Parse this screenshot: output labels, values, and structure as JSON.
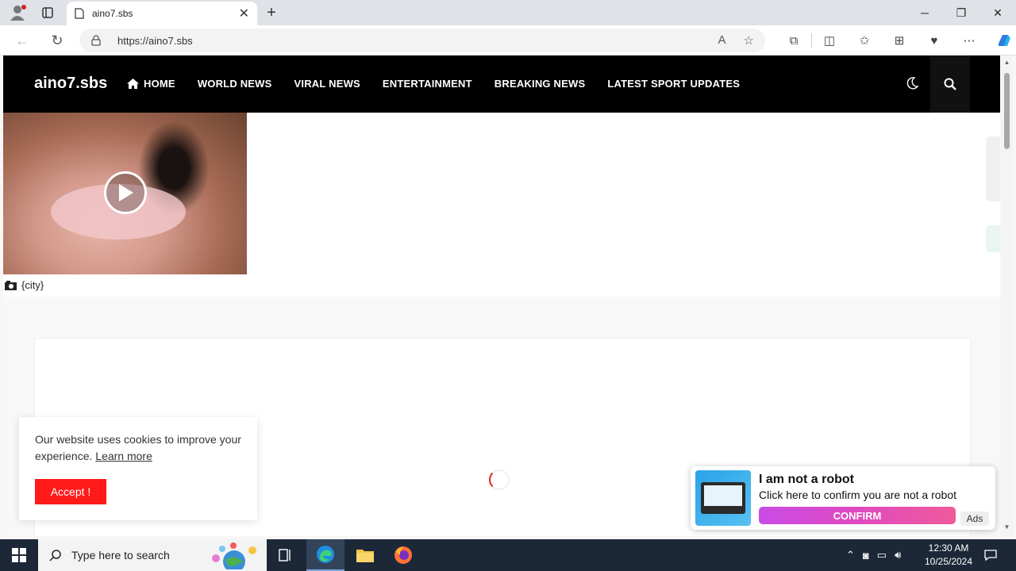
{
  "browser": {
    "tab_title": "aino7.sbs",
    "url": "https://aino7.sbs"
  },
  "site": {
    "logo": "aino7.sbs",
    "menu": [
      {
        "label": "HOME"
      },
      {
        "label": "WORLD NEWS"
      },
      {
        "label": "VIRAL NEWS"
      },
      {
        "label": "ENTERTAINMENT"
      },
      {
        "label": "BREAKING NEWS"
      },
      {
        "label": "LATEST SPORT UPDATES"
      }
    ],
    "city_caption": "{city}"
  },
  "cookie": {
    "text": "Our website uses cookies to improve your experience.",
    "learn_more": "Learn more",
    "accept": "Accept !"
  },
  "ad": {
    "heading": "I am not a robot",
    "subtext": "Click here to confirm you are not a robot",
    "button": "CONFIRM",
    "badge": "Ads"
  },
  "taskbar": {
    "search_placeholder": "Type here to search",
    "time": "12:30 AM",
    "date": "10/25/2024"
  },
  "colors": {
    "header_bg": "#000000",
    "accept_bg": "#ff1a1a",
    "confirm_gradient": "#c94be6"
  }
}
